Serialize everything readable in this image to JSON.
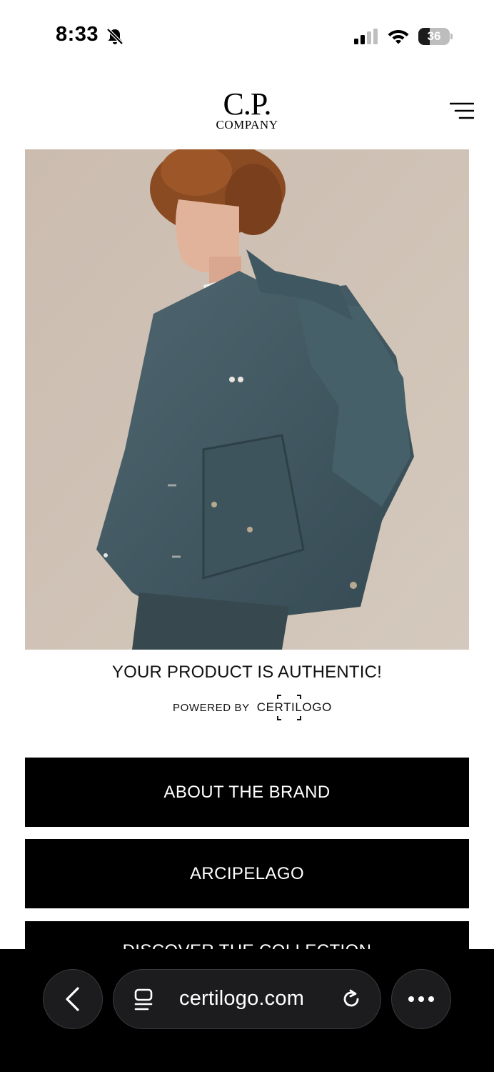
{
  "status_bar": {
    "time": "8:33",
    "battery_level": "36",
    "battery_fraction": 0.36
  },
  "header": {
    "logo_line1": "C.P.",
    "logo_line2": "COMPANY"
  },
  "hero": {
    "image_subject": "model in dark teal jacket"
  },
  "authenticity": {
    "title": "YOUR PRODUCT IS AUTHENTIC!",
    "powered_by": "POWERED BY",
    "certilogo": "CERTILOGO"
  },
  "buttons": [
    {
      "label": "ABOUT THE BRAND"
    },
    {
      "label": "ARCIPELAGO"
    },
    {
      "label": "DISCOVER THE COLLECTION"
    }
  ],
  "browser": {
    "url": "certilogo.com"
  },
  "icons": [
    "bell-slash-icon",
    "signal-icon",
    "wifi-icon",
    "menu-icon",
    "back-chevron-icon",
    "tabs-icon",
    "reload-icon",
    "more-icon"
  ]
}
